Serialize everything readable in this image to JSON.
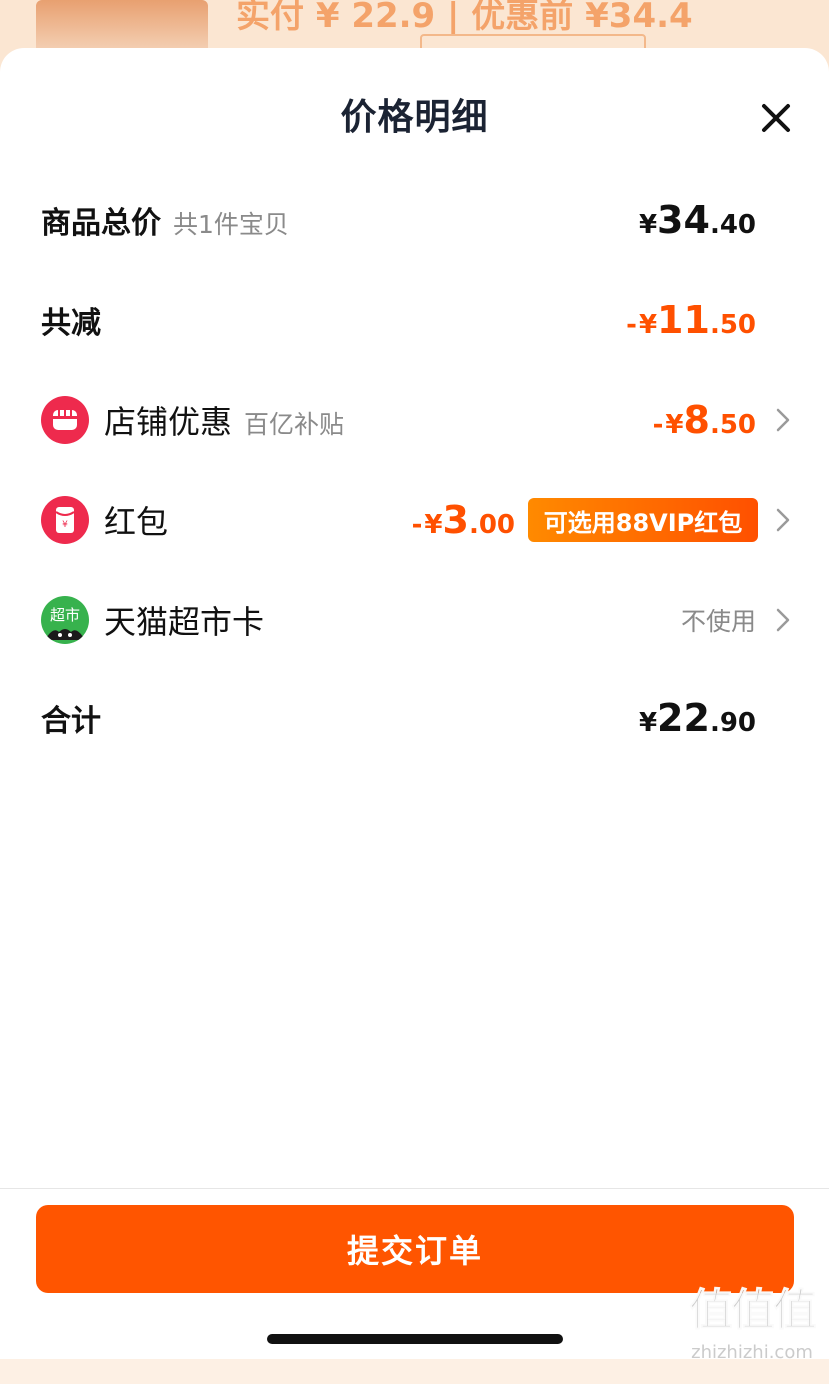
{
  "sheet": {
    "title": "价格明细",
    "close_icon": "close-icon"
  },
  "background_page": {
    "price_preview": "实付 ¥ 22.9 | 优惠前 ¥34.4"
  },
  "rows": {
    "total": {
      "label": "商品总价",
      "sublabel": "共1件宝贝",
      "yen": "¥",
      "int": "34",
      "dec": ".40"
    },
    "reduction": {
      "label": "共减",
      "minus": "-",
      "yen": "¥",
      "int": "11",
      "dec": ".50"
    },
    "shop_discount": {
      "icon": "shop-icon",
      "label": "店铺优惠",
      "sublabel": "百亿补贴",
      "minus": "-",
      "yen": "¥",
      "int": "8",
      "dec": ".50"
    },
    "red_packet": {
      "icon": "red-packet-icon",
      "label": "红包",
      "minus": "-",
      "yen": "¥",
      "int": "3",
      "dec": ".00",
      "badge": "可选用88VIP红包"
    },
    "market_card": {
      "icon": "tmall-market-icon",
      "icon_text": "超市",
      "label": "天猫超市卡",
      "value": "不使用"
    },
    "sum": {
      "label": "合计",
      "yen": "¥",
      "int": "22",
      "dec": ".90"
    }
  },
  "footer": {
    "submit_label": "提交订单"
  },
  "watermark": {
    "glyphs": "值值值",
    "site": "zhizhizhi.com"
  },
  "colors": {
    "accent": "#ff5000",
    "button": "#ff5500",
    "badge_start": "#ff8a00",
    "icon_red": "#ee2a4d",
    "icon_green": "#37b24d"
  }
}
